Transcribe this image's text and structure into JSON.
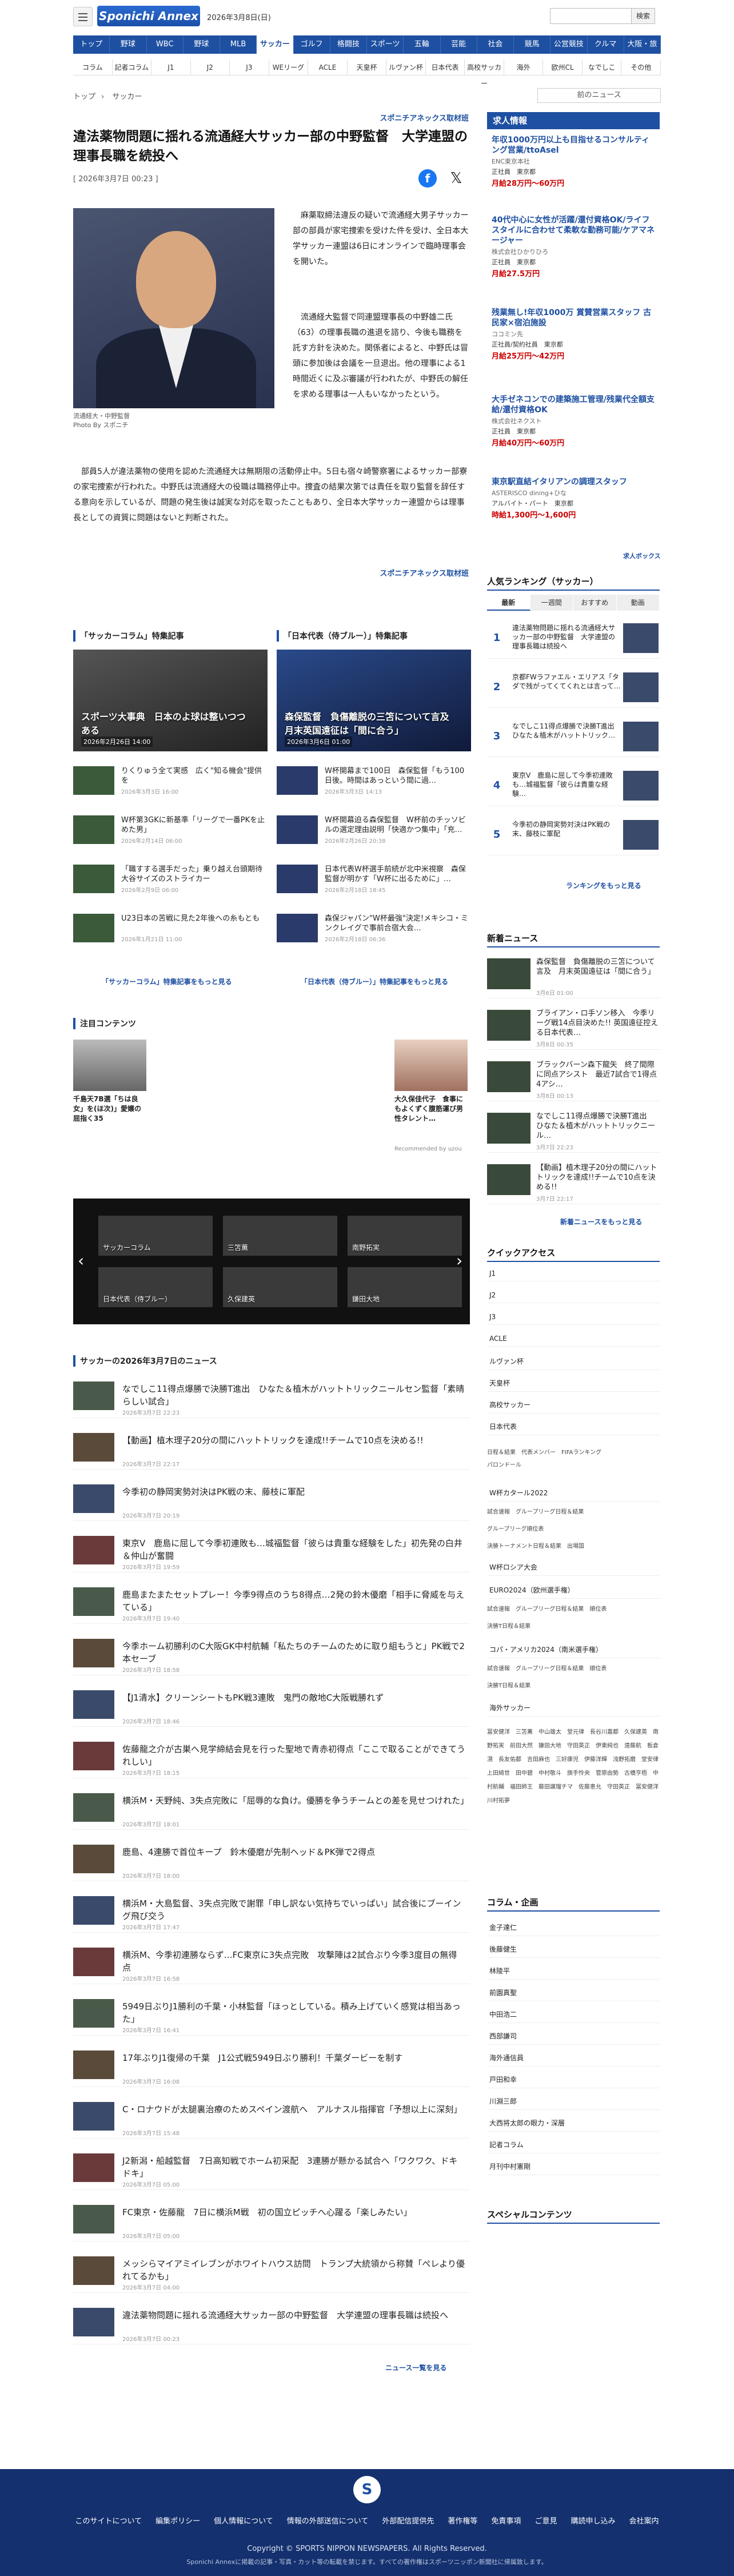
{
  "header": {
    "logo": "Sponichi Annex",
    "date": "2026年3月8日(日)",
    "search_button": "検索",
    "search_placeholder": ""
  },
  "nav1": [
    "トップ",
    "野球",
    "WBC",
    "野球",
    "MLB",
    "サッカー",
    "ゴルフ",
    "格闘技",
    "スポーツ",
    "五輪",
    "芸能",
    "社会",
    "競馬",
    "公営競技",
    "クルマ",
    "大阪・旅"
  ],
  "nav2": [
    "コラム",
    "記者コラム",
    "J1",
    "J2",
    "J3",
    "WEリーグ",
    "ACLE",
    "天皇杯",
    "ルヴァン杯",
    "日本代表",
    "高校サッカー",
    "海外",
    "欧州CL",
    "なでしこ",
    "その他"
  ],
  "crumbs": [
    "トップ",
    "サッカー"
  ],
  "prevnext": "前のニュース",
  "article": {
    "source": "スポニチアネックス取材班",
    "title": "違法薬物問題に揺れる流通経大サッカー部の中野監督　大学連盟の理事長職を続投へ",
    "date": "[ 2026年3月7日 00:23 ]",
    "caption1": "流通経大・中野監督",
    "caption2": "Photo By スポニチ",
    "p1": "　麻薬取締法違反の疑いで流通経大男子サッカー部の部員が家宅捜索を受けた件を受け、全日本大学サッカー連盟は6日にオンラインで臨時理事会を開いた。",
    "p2": "　流通経大監督で同連盟理事長の中野雄二氏（63）の理事長職の進退を諮り、今後も職務を託す方針を決めた。関係者によると、中野氏は冒頭に参加後は会議を一旦退出。他の理事による1時間近くに及ぶ審議が行われたが、中野氏の解任を求める理事は一人もいなかったという。",
    "p3": "　部員5人が違法薬物の使用を認めた流通経大は無期限の活動停止中。5日も宿々崎警察署によるサッカー部寮の家宅捜索が行われた。中野氏は流通経大の役職は職務停止中。捜査の結果次第では責任を取り監督を辞任する意向を示しているが、問題の発生後は誠実な対応を取ったこともあり、全日本大学サッカー連盟からは理事長としての資質に問題はないと判断された。",
    "source2": "スポニチアネックス取材班"
  },
  "features": {
    "left": {
      "head": "「サッカーコラム」特集記事",
      "big": "スポーツ大事典　日本のよ球は整いつつある",
      "bigdate": "2026年2月26日 14:00",
      "more": "「サッカーコラム」特集記事をもっと見る",
      "items": [
        {
          "t": "りくりゅう全て実感　広く\"知る機会\"提供を",
          "d": "2026年3月3日 16:00"
        },
        {
          "t": "W杯第3GKに新基準「リーグで一番PKを止めた男」",
          "d": "2026年2月14日 06:00"
        },
        {
          "t": "「職すする選手だった」乗り越え台頭期待　大谷サイズのストライカー",
          "d": "2026年2月9日 06:00"
        },
        {
          "t": "U23日本の苦戦に見た2年後への糸もとも",
          "d": "2026年1月21日 11:00"
        }
      ]
    },
    "right": {
      "head": "「日本代表（侍ブルー）」特集記事",
      "big": "森保監督　負傷離脱の三笘について言及　月末英国遠征は「間に合う」",
      "bigdate": "2026年3月6日 01:00",
      "more": "「日本代表（侍ブルー）」特集記事をもっと見る",
      "items": [
        {
          "t": "W杯開幕まで100日　森保監督「もう100日後。時間はあっという間に過…",
          "d": "2026年3月3日 14:13"
        },
        {
          "t": "W杯開幕迫る森保監督　W杯前のチッソビルの選定理由説明「快適かつ集中」「充…",
          "d": "2026年2月26日 20:38"
        },
        {
          "t": "日本代表W杯選手前続が北中米視察　森保監督が明かす「W杯に出るために」…",
          "d": "2026年2月18日 18:45"
        },
        {
          "t": "森保ジャパン\"W杯最強\"決定!メキシコ・ミンクレイグで事前合宿大会…",
          "d": "2026年2月18日 06:36"
        }
      ]
    }
  },
  "pickup": {
    "head": "注目コンテンツ",
    "left": "千島天7B選「ちは良女」を(ほ次)」愛嬢の屈指く35",
    "right": "大久保佳代子　食事にもよくずく腹筋運び男性タレント…",
    "rec": "Recommended by uzou"
  },
  "carousel": [
    "サッカーコラム",
    "三笘薫",
    "南野拓実",
    "日本代表（侍ブルー）",
    "久保建英",
    "鎌田大地"
  ],
  "news": {
    "head": "サッカーの2026年3月7日のニュース",
    "more": "ニュース一覧を見る",
    "items": [
      {
        "t": "なでしこ11得点爆勝で決勝T進出　ひなた＆植木がハットトリックニールセン監督「素晴らしい試合」",
        "d": "2026年3月7日 22:23"
      },
      {
        "t": "【動画】植木理子20分の間にハットトリックを達成!!チームで10点を決める!!",
        "d": "2026年3月7日 22:17"
      },
      {
        "t": "今季初の静岡実勢対決はPK戦の末、藤枝に軍配",
        "d": "2026年3月7日 20:19"
      },
      {
        "t": "東京V　鹿島に屈して今季初連敗も…城福監督「彼らは貴重な経験をした」初先発の白井＆仲山が奮闘",
        "d": "2026年3月7日 19:59"
      },
      {
        "t": "鹿島またまたセットプレー！今季9得点のうち8得点…2発の鈴木優磨「相手に脅威を与えている」",
        "d": "2026年3月7日 19:40"
      },
      {
        "t": "今季ホーム初勝利のC大阪GK中村航輔「私たちのチームのために取り組もうと」PK戦で2本セーブ",
        "d": "2026年3月7日 18:58"
      },
      {
        "t": "【J1清水】クリーンシートもPK戦3連敗　鬼門の敵地C大阪戦勝れず",
        "d": "2026年3月7日 18:46"
      },
      {
        "t": "佐藤龍之介が古巣へ見学締結会見を行った聖地で青赤初得点「ここで取ることができてうれしい」",
        "d": "2026年3月7日 18:15"
      },
      {
        "t": "横浜M・天野純、3失点完敗に「屈辱的な負け。優勝を争うチームとの差を見せつけれた」",
        "d": "2026年3月7日 18:01"
      },
      {
        "t": "鹿島、4連勝で首位キープ　鈴木優磨が先制ヘッド＆PK弾で2得点",
        "d": "2026年3月7日 18:00"
      },
      {
        "t": "横浜M・大島監督、3失点完敗で謝罪「申し訳ない気持ちでいっぱい」試合後にブーイング飛び交う",
        "d": "2026年3月7日 17:47"
      },
      {
        "t": "横浜M、今季初連勝ならず…FC東京に3失点完敗　攻撃陣は2試合ぶり今季3度目の無得点",
        "d": "2026年3月7日 16:58"
      },
      {
        "t": "5949日ぶりJ1勝利の千葉・小林監督「ほっとしている。積み上げていく感覚は相当あった」",
        "d": "2026年3月7日 16:41"
      },
      {
        "t": "17年ぶりJ1復帰の千葉　J1公式戦5949日ぶり勝利！千葉ダービーを制す",
        "d": "2026年3月7日 16:08"
      },
      {
        "t": "C・ロナウドが太腿裏治療のためスペイン渡航へ　アルナスル指揮官「予想以上に深刻」",
        "d": "2026年3月7日 15:48"
      },
      {
        "t": "J2新潟・船越監督　7日高知戦でホーム初采配　3連勝が懸かる試合へ「ワクワク、ドキドキ」",
        "d": "2026年3月7日 05:00"
      },
      {
        "t": "FC東京・佐藤龍　7日に横浜M戦　初の国立ピッチへ心躍る「楽しみたい」",
        "d": "2026年3月7日 05:00"
      },
      {
        "t": "メッシらマイアミイレブンがホワイトハウス訪問　トランプ大統領から称賛「ぺレより優れてるかも」",
        "d": "2026年3月7日 04:00"
      },
      {
        "t": "違法薬物問題に揺れる流通経大サッカー部の中野監督　大学連盟の理事長職は続投へ",
        "d": "2026年3月7日 00:23"
      }
    ]
  },
  "sidebar": {
    "jobs_head": "求人情報",
    "jobs": [
      {
        "t": "年収1000万円以上も目指せるコンサルティング営業/ttoAsel",
        "c": "ENC東京本社",
        "r": "正社員　東京都",
        "p": "月給28万円〜60万円"
      },
      {
        "t": "40代中心に女性が活躍/還付資格OK/ライフスタイルに合わせて柔軟な勤務可能/ケアマネージャー",
        "c": "株式会社ひかりひろ",
        "r": "正社員　東京都",
        "p": "月給27.5万円"
      },
      {
        "t": "残業無し!年収1000万 賞賛営業スタッフ 古民家×宿泊施設",
        "c": "ココミン先",
        "r": "正社員/契約社員　東京都",
        "p": "月給25万円〜42万円"
      },
      {
        "t": "大手ゼネコンでの建築施工管理/残業代全額支給/還付資格OK",
        "c": "株式会社ネクスト",
        "r": "正社員　東京都",
        "p": "月給40万円〜60万円"
      },
      {
        "t": "東京駅直結イタリアンの調理スタッフ",
        "c": "ASTERISCO dining+ひな",
        "r": "アルバイト・パート　東京都",
        "p": "時給1,300円〜1,600円"
      }
    ],
    "jobs_brand": "求人ボックス",
    "rank_head": "人気ランキング（サッカー）",
    "rank_tabs": [
      "最新",
      "一週間",
      "おすすめ",
      "動画"
    ],
    "ranks": [
      {
        "n": "1",
        "t": "違法薬物問題に揺れる流通経大サッカー部の中野監督　大学連盟の理事長職は続投へ"
      },
      {
        "n": "2",
        "t": "京都FWラファエル・エリアス「タダで残がってくてくれとは言って…"
      },
      {
        "n": "3",
        "t": "なでしこ11得点爆勝で決勝T進出　ひなた＆植木がハットトリック…"
      },
      {
        "n": "4",
        "t": "東京V　鹿島に屈して今季初連敗も…城福監督「彼らは貴重な経験…"
      },
      {
        "n": "5",
        "t": "今季初の静岡実勢対決はPK戦の末、藤枝に軍配"
      }
    ],
    "rank_more": "ランキングをもっと見る",
    "new_head": "新着ニュース",
    "new": [
      {
        "t": "森保監督　負傷離脱の三笘について言及　月末英国遠征は「間に合う」",
        "d": "3月6日 01:00"
      },
      {
        "t": "ブライアン・ロ手ソン移入　今季リーグ戦14点目決めた!! 英国遠征控える日本代表…",
        "d": "3月8日 00:35"
      },
      {
        "t": "ブラックバーン森下龍矢　終了間際に同点アシスト　最近7試合で1得点4アシ…",
        "d": "3月8日 00:13"
      },
      {
        "t": "なでしこ11得点爆勝で決勝T進出　ひなた＆植木がハットトリックニール…",
        "d": "3月7日 22:23"
      },
      {
        "t": "【動画】植木理子20分の間にハットトリックを達成!!チームで10点を決める!!",
        "d": "3月7日 22:17"
      }
    ],
    "new_more": "新着ニュースをもっと見る",
    "quick_head": "クイックアクセス",
    "quick": [
      "J1",
      "J2",
      "J3",
      "ACLE",
      "ルヴァン杯",
      "天皇杯",
      "高校サッカー",
      "日本代表"
    ],
    "quick_small1": "日程＆結果　代表メンバー　FIFAランキング",
    "quick_small1b": "パロンドール",
    "quick2": "W杯カタール2022",
    "quick_small2": "試合速報　グループリーグ日程＆結果",
    "quick_small2b": "グループリーグ順位表",
    "quick_small2c": "決勝トーナメント日程＆結果　出場国",
    "quick3": "W杯ロシア大会",
    "quick4": "EURO2024（欧州選手権）",
    "quick_small4": "試合速報　グループリーグ日程＆結果　順位表",
    "quick_small4b": "決勝T日程＆結果",
    "quick5": "コパ・アメリカ2024（南米選手権）",
    "quick_small5": "試合速報　グループリーグ日程＆結果　順位表",
    "quick_small5b": "決勝T日程＆結果",
    "quick6": "海外サッカー",
    "players": "冨安健洋　三笘薫　中山雄太　堂元律　長谷川嘉都　久保建英　南野拓実　前田大然　鎌田大地　守田英正　伊東純也　遠藤航　板倉滉　長友佑都　吉田麻也　三好康児　伊藤洋輝　浅野拓磨　堂安律　上田綺世　田中碧　中村敬斗　旗手怜央　菅原由勢　古橋亨梧　中村航輔　福田師王　藤田譲瑠チマ　佐藤恵允　守田英正　冨安健洋　川村拓夢",
    "column_head": "コラム・企画",
    "columns": [
      "金子達仁",
      "後藤健生",
      "林陵平",
      "前園真聖",
      "中田浩二",
      "西部謙司",
      "海外通信員",
      "戸田和幸",
      "川淵三郎",
      "大西将太郎の眼力・深層",
      "記者コラム",
      "月刊中村憲剛"
    ],
    "special_head": "スペシャルコンテンツ"
  },
  "footer": {
    "links": [
      "このサイトについて",
      "編集ポリシー",
      "個人情報について",
      "情報の外部送信について",
      "外部配信提供先",
      "著作権等",
      "免責事項",
      "ご意見",
      "購読申し込み",
      "会社案内"
    ],
    "copy": "Copyright © SPORTS NIPPON NEWSPAPERS. All Rights Reserved.",
    "copy2": "Sponichi Annexに掲載の記事・写真・カット等の転載を禁じます。すべての著作権はスポーツニッポン新聞社に帰属致します。"
  }
}
